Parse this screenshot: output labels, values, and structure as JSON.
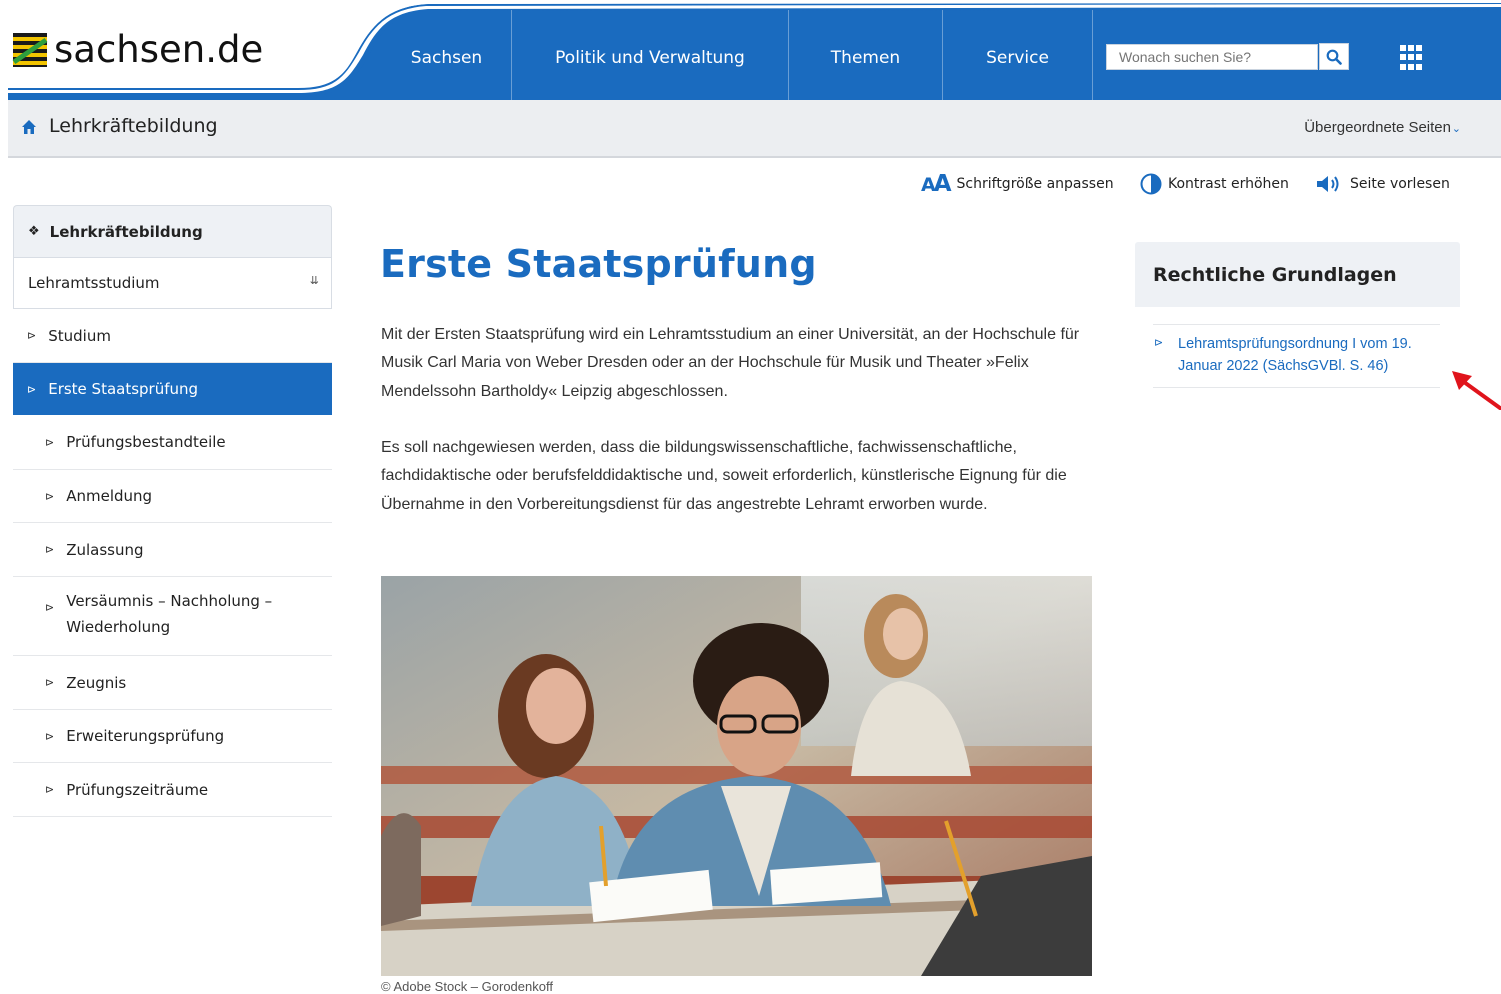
{
  "header": {
    "logo_text": "sachsen.de",
    "nav": [
      "Sachsen",
      "Politik und Verwaltung",
      "Themen",
      "Service"
    ],
    "search_placeholder": "Wonach suchen Sie?",
    "brand_color": "#1a6bbf"
  },
  "breadcrumb": {
    "title": "Lehrkräftebildung",
    "parent_pages": "Übergeordnete Seiten"
  },
  "a11y": {
    "font_size": "Schriftgröße anpassen",
    "contrast": "Kontrast erhöhen",
    "read": "Seite vorlesen"
  },
  "sidebar": {
    "top": "Lehrkräftebildung",
    "sub": "Lehramtsstudium",
    "items": [
      {
        "label": "Studium",
        "level": 1
      },
      {
        "label": "Erste Staatsprüfung",
        "level": 1,
        "active": true
      },
      {
        "label": "Prüfungsbestandteile",
        "level": 2
      },
      {
        "label": "Anmeldung",
        "level": 2
      },
      {
        "label": "Zulassung",
        "level": 2
      },
      {
        "label": "Versäumnis – Nachholung – Wiederholung",
        "level": 2
      },
      {
        "label": "Zeugnis",
        "level": 2
      },
      {
        "label": "Erweiterungsprüfung",
        "level": 2
      },
      {
        "label": "Prüfungszeiträume",
        "level": 2
      }
    ]
  },
  "main": {
    "title": "Erste Staatsprüfung",
    "para1": "Mit der Ersten Staatsprüfung wird ein Lehramtsstudium an einer Universität, an der Hochschule für Musik Carl Maria von Weber Dresden oder an der Hochschule für Musik und Theater »Felix Mendelssohn Bartholdy« Leipzig abgeschlossen.",
    "para2": "Es soll nachgewiesen werden, dass die bildungswissenschaftliche, fachwissenschaftliche, fachdidaktische oder berufsfelddidaktische und, soweit erforderlich, künstlerische Eignung für die Übernahme in den Vorbereitungsdienst für das angestrebte Lehramt erworben wurde.",
    "caption": "© Adobe Stock – Gorodenkoff"
  },
  "aside": {
    "heading": "Rechtliche Grundlagen",
    "link": "Lehramtsprüfungsordnung I vom 19. Januar 2022 (SächsGVBl. S. 46)"
  }
}
